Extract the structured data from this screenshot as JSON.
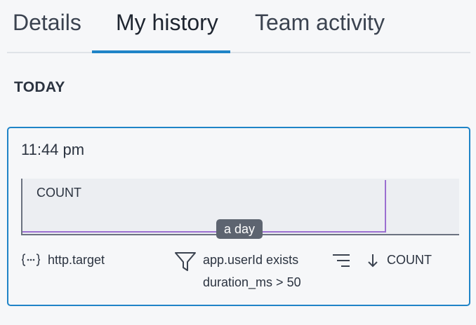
{
  "tabs": [
    {
      "label": "Details"
    },
    {
      "label": "My history"
    },
    {
      "label": "Team activity"
    }
  ],
  "active_tab": "My history",
  "section": {
    "label": "TODAY"
  },
  "history_item": {
    "time": "11:44 pm",
    "chart": {
      "label": "COUNT",
      "tooltip": "a day",
      "line_color": "#9b6fd1"
    },
    "group_by": {
      "icon": "braces-icon",
      "value": "http.target"
    },
    "filters": {
      "icon": "filter-icon",
      "items": [
        "app.userId exists",
        "duration_ms > 50"
      ]
    },
    "order": {
      "icon": "sort-lines-icon",
      "direction_icon": "arrow-down-icon",
      "value": "COUNT"
    }
  },
  "colors": {
    "accent": "#1f84c7",
    "series": "#9b6fd1",
    "chart_bg": "#eceef2",
    "tooltip_bg": "#5d6470"
  }
}
